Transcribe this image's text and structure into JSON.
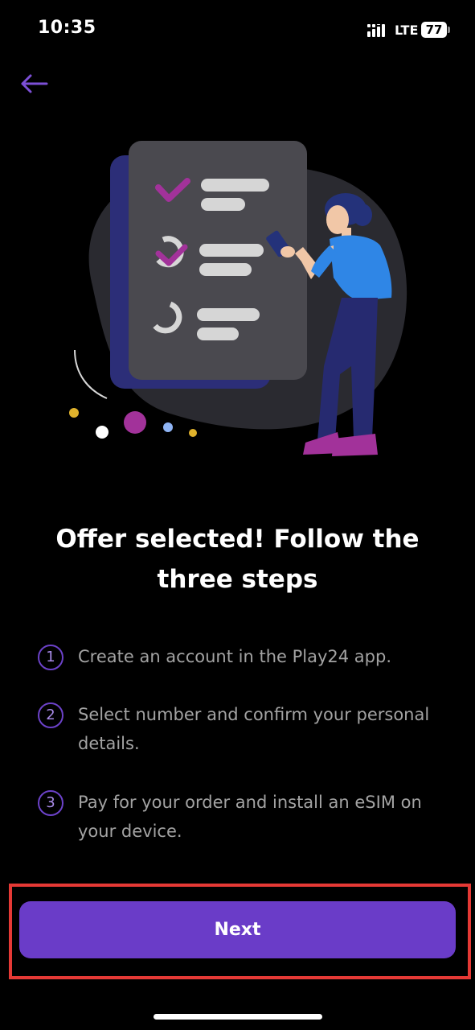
{
  "status_bar": {
    "time": "10:35",
    "network": "LTE",
    "battery": "77"
  },
  "back_button": {
    "icon": "arrow-left-icon"
  },
  "illustration": {
    "icon": "checklist-illustration"
  },
  "headline": {
    "line1": "Offer selected! Follow the",
    "line2": "three steps"
  },
  "steps": [
    {
      "number": "1",
      "text": "Create an account in the Play24 app."
    },
    {
      "number": "2",
      "text": "Select number and confirm your personal details."
    },
    {
      "number": "3",
      "text": "Pay for your order and install an eSIM on your device."
    }
  ],
  "next_button": {
    "label": "Next"
  },
  "colors": {
    "accent": "#6a3cc8",
    "highlight": "#e53935",
    "background": "#000000",
    "step_text": "#a3a3a3"
  }
}
